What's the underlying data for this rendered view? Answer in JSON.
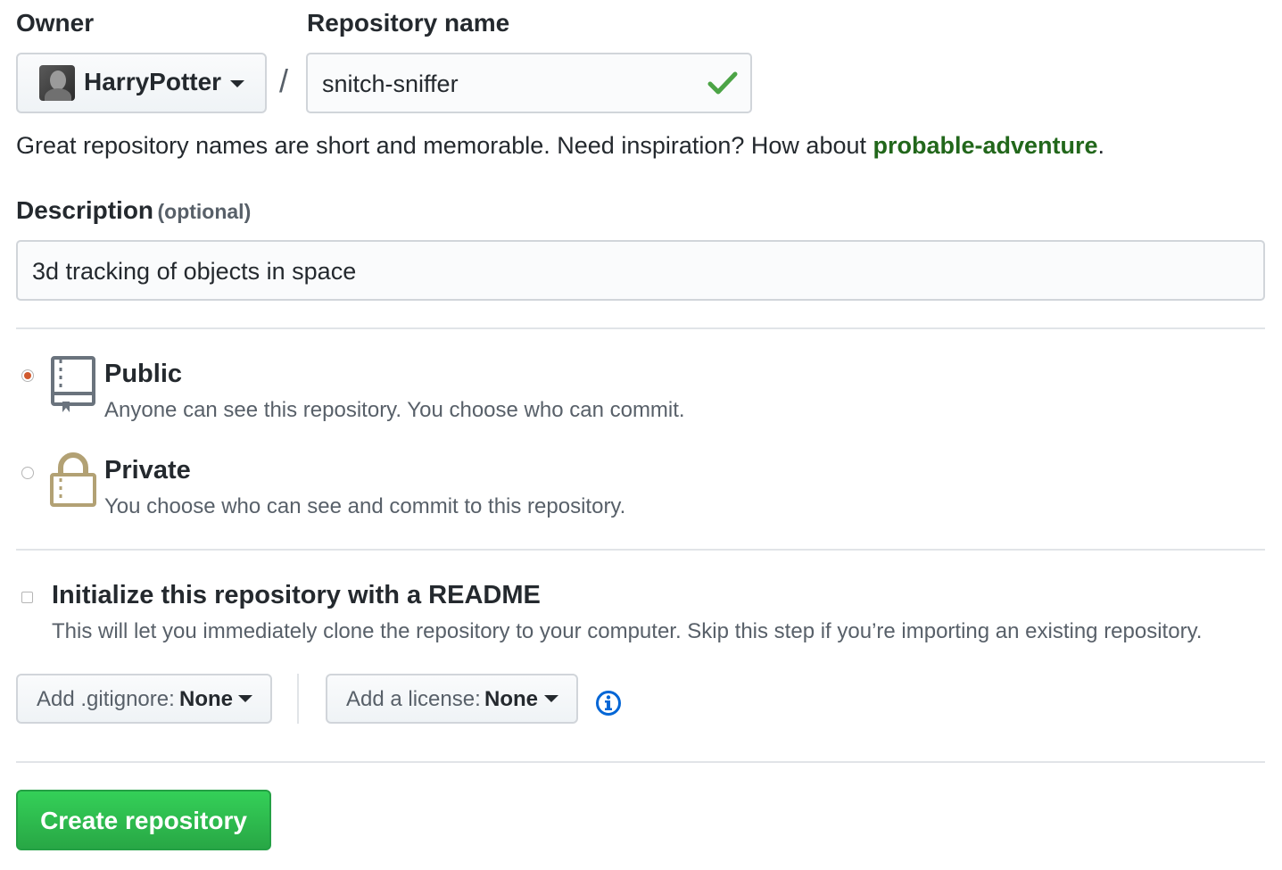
{
  "owner": {
    "label": "Owner",
    "value": "HarryPotter"
  },
  "repo": {
    "label": "Repository name",
    "value": "snitch-sniffer",
    "separator": "/"
  },
  "hint": {
    "text": "Great repository names are short and memorable. Need inspiration? How about ",
    "suggestion": "probable-adventure",
    "end": "."
  },
  "description": {
    "label": "Description",
    "optional": "(optional)",
    "value": "3d tracking of objects in space"
  },
  "visibility": {
    "public": {
      "title": "Public",
      "desc": "Anyone can see this repository. You choose who can commit.",
      "selected": true
    },
    "private": {
      "title": "Private",
      "desc": "You choose who can see and commit to this repository.",
      "selected": false
    }
  },
  "readme": {
    "title": "Initialize this repository with a README",
    "desc": "This will let you immediately clone the repository to your computer. Skip this step if you’re importing an existing repository.",
    "checked": false
  },
  "gitignore": {
    "prefix": "Add .gitignore:",
    "value": "None"
  },
  "license": {
    "prefix": "Add a license:",
    "value": "None"
  },
  "create_button": "Create repository",
  "colors": {
    "accent_green": "#2cbe4e",
    "suggestion_green": "#22671b",
    "valid_check": "#4ca446",
    "radio_selected": "#d0592e",
    "info_blue": "#0366d6"
  }
}
